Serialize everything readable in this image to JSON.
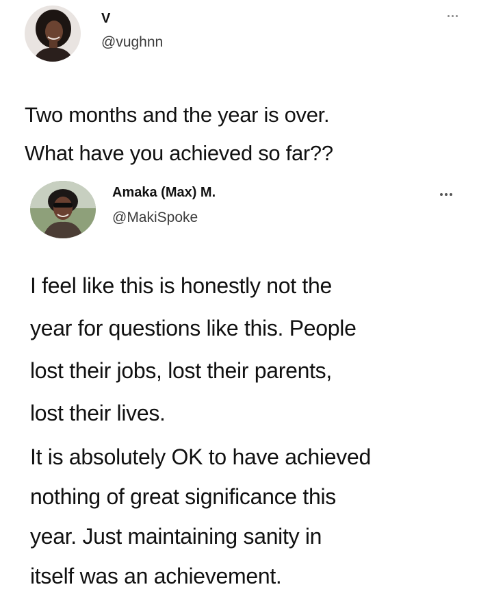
{
  "tweets": [
    {
      "author": {
        "name": "V",
        "handle": "@vughnn"
      },
      "text": [
        "Two months and the year is over.",
        "What have you achieved so far??"
      ]
    },
    {
      "author": {
        "name": "Amaka (Max) M.",
        "handle": "@MakiSpoke"
      },
      "paragraphs": [
        [
          "I feel like this is honestly not the",
          "year for questions like this. People",
          "lost their jobs, lost their parents,",
          "lost their lives."
        ],
        [
          "It is absolutely OK to have achieved",
          "nothing of great significance this",
          "year. Just maintaining sanity in",
          "itself was an achievement."
        ]
      ]
    }
  ],
  "icons": {
    "more": "more-options-icon",
    "avatar": "avatar"
  }
}
